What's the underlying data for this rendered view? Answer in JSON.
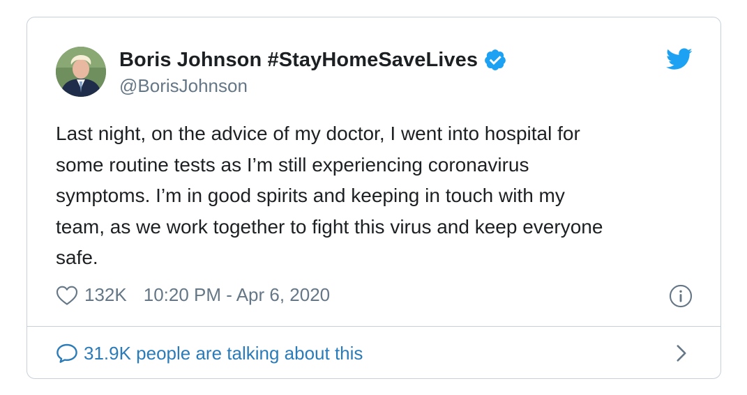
{
  "tweet": {
    "author": {
      "display_name": "Boris Johnson #StayHomeSaveLives",
      "handle": "@BorisJohnson",
      "verified": true,
      "avatar_icon": "profile-photo"
    },
    "text": "Last night, on the advice of my doctor, I went into hospital for\nsome routine tests as I’m still experiencing coronavirus\nsymptoms. I’m in good spirits and keeping in touch with my\nteam, as we work together to fight this virus and keep everyone\nsafe.",
    "likes": "132K",
    "timestamp": "10:20 PM - Apr 6, 2020",
    "footer_text": "31.9K people are talking about this"
  },
  "icons": {
    "brand": "twitter-bird-icon",
    "verified": "verified-badge-icon",
    "like": "heart-icon",
    "info": "info-icon",
    "conversation": "speech-bubble-icon",
    "next": "chevron-right-icon"
  },
  "colors": {
    "twitter_blue": "#1da1f2",
    "link_blue": "#2b7bb9",
    "text": "#1c2022",
    "muted": "#657786",
    "border": "#c7d0d8"
  }
}
